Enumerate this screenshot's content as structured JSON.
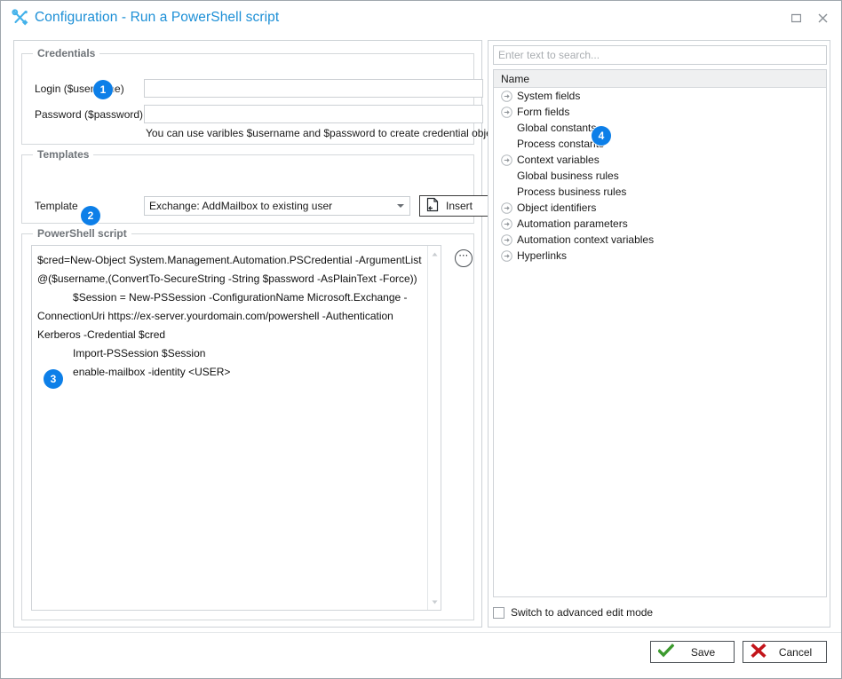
{
  "window": {
    "title": "Configuration - Run a PowerShell script",
    "icon": "tools-icon",
    "maximize_label": "Maximize",
    "close_label": "Close",
    "accent_color": "#1c8fd6",
    "badge_color": "#0d7fe8"
  },
  "credentials": {
    "group_title": "Credentials",
    "login_label": "Login ($username)",
    "login_value": "",
    "password_label": "Password  ($password)",
    "password_value": "",
    "hint": "You can use varibles $username and $password to create credential object"
  },
  "templates": {
    "group_title": "Templates",
    "template_label": "Template",
    "selected_template": "Exchange: AddMailbox to existing user",
    "insert_label": "Insert",
    "insert_icon": "paste-icon"
  },
  "script": {
    "group_title": "PowerShell script",
    "content": "$cred=New-Object System.Management.Automation.PSCredential -ArgumentList @($username,(ConvertTo-SecureString -String $password -AsPlainText -Force))\n            $Session = New-PSSession -ConfigurationName Microsoft.Exchange -ConnectionUri https://ex-server.yourdomain.com/powershell -Authentication Kerberos -Credential $cred\n            Import-PSSession $Session\n            enable-mailbox -identity <USER>",
    "more_button_icon": "ellipsis-circle-icon",
    "scroll_up_icon": "scroll-up-arrow-icon",
    "scroll_down_icon": "scroll-down-arrow-icon"
  },
  "right_panel": {
    "search_placeholder": "Enter text to search...",
    "search_value": "",
    "column_header": "Name",
    "tree_items": [
      {
        "label": "System fields",
        "expandable": true
      },
      {
        "label": "Form fields",
        "expandable": true
      },
      {
        "label": "Global constants",
        "expandable": false
      },
      {
        "label": "Process constants",
        "expandable": false
      },
      {
        "label": "Context variables",
        "expandable": true
      },
      {
        "label": "Global business rules",
        "expandable": false
      },
      {
        "label": "Process business rules",
        "expandable": false
      },
      {
        "label": "Object identifiers",
        "expandable": true
      },
      {
        "label": "Automation parameters",
        "expandable": true
      },
      {
        "label": "Automation context variables",
        "expandable": true
      },
      {
        "label": "Hyperlinks",
        "expandable": true
      }
    ],
    "advanced_checkbox_label": "Switch to advanced edit mode",
    "advanced_checkbox_checked": false
  },
  "footer": {
    "save_label": "Save",
    "save_icon": "green-check-icon",
    "cancel_label": "Cancel",
    "cancel_icon": "red-x-icon"
  },
  "badges": {
    "one": "1",
    "two": "2",
    "three": "3",
    "four": "4"
  }
}
